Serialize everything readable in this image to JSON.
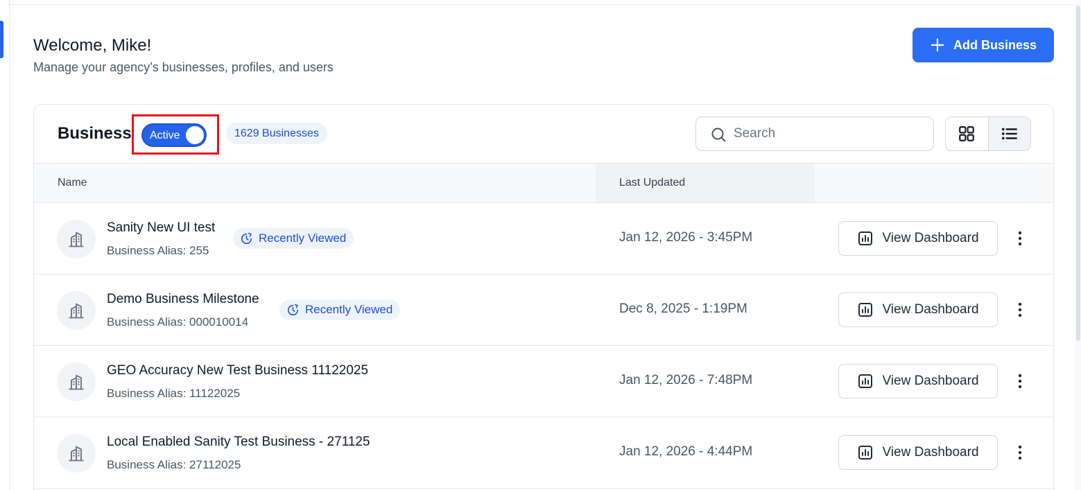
{
  "header": {
    "welcome_title": "Welcome, Mike!",
    "welcome_subtitle": "Manage your agency’s businesses, profiles, and users",
    "add_button_label": "Add Business",
    "add_icon": "plus-icon"
  },
  "business_card": {
    "title": "Business",
    "toggle_label": "Active",
    "toggle_on": true,
    "count_label": "1629 Businesses",
    "search_placeholder": "Search",
    "search_icon": "search-icon",
    "view_modes": [
      "grid-view-icon",
      "list-view-icon"
    ],
    "selected_view": "list"
  },
  "table": {
    "columns": [
      "Name",
      "Last Updated"
    ],
    "rows": [
      {
        "name": "Sanity New UI test",
        "alias": "Business Alias: 255",
        "badge": "Recently Viewed",
        "last_updated": "Jan 12, 2026 - 3:45PM",
        "action_label": "View Dashboard"
      },
      {
        "name": "Demo Business Milestone",
        "alias": "Business Alias: 000010014",
        "badge": "Recently Viewed",
        "last_updated": "Dec 8, 2025 - 1:19PM",
        "action_label": "View Dashboard"
      },
      {
        "name": "GEO Accuracy New Test Business 11122025",
        "alias": "Business Alias: 11122025",
        "badge": "",
        "last_updated": "Jan 12, 2026 - 7:48PM",
        "action_label": "View Dashboard"
      },
      {
        "name": "Local Enabled Sanity Test Business - 271125",
        "alias": "Business Alias: 27112025",
        "badge": "",
        "last_updated": "Jan 12, 2026 - 4:44PM",
        "action_label": "View Dashboard"
      }
    ]
  },
  "colors": {
    "primary": "#2b6ef5",
    "badge_bg": "#eef3fb",
    "badge_text": "#1d4ed8",
    "highlight_border": "#e8131b"
  }
}
